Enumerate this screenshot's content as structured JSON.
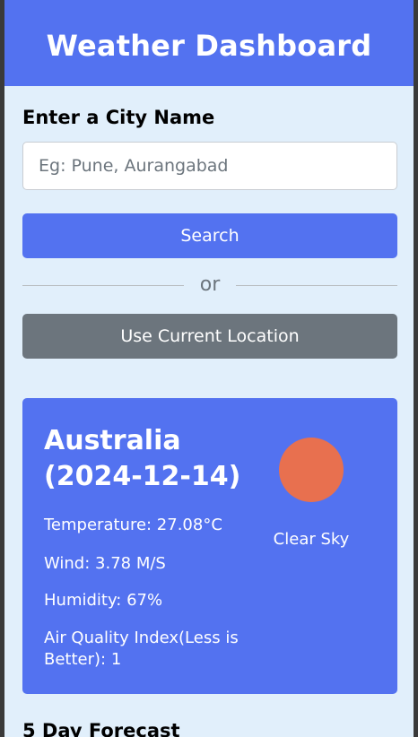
{
  "header": {
    "title": "Weather Dashboard"
  },
  "search": {
    "label": "Enter a City Name",
    "placeholder": "Eg: Pune, Aurangabad",
    "value": "",
    "search_button": "Search",
    "separator_text": "or",
    "location_button": "Use Current Location"
  },
  "current": {
    "city": "Australia",
    "date": "(2024-12-14)",
    "temperature": "Temperature: 27.08°C",
    "wind": "Wind: 3.78 M/S",
    "humidity": "Humidity: 67%",
    "aqi": "Air Quality Index(Less is Better): 1",
    "condition": "Clear Sky",
    "icon": "sun-icon"
  },
  "forecast": {
    "heading": "5 Day Forecast"
  },
  "colors": {
    "primary": "#5372f0",
    "secondary": "#6c757d",
    "background": "#e1effb",
    "sun": "#e8704f"
  }
}
